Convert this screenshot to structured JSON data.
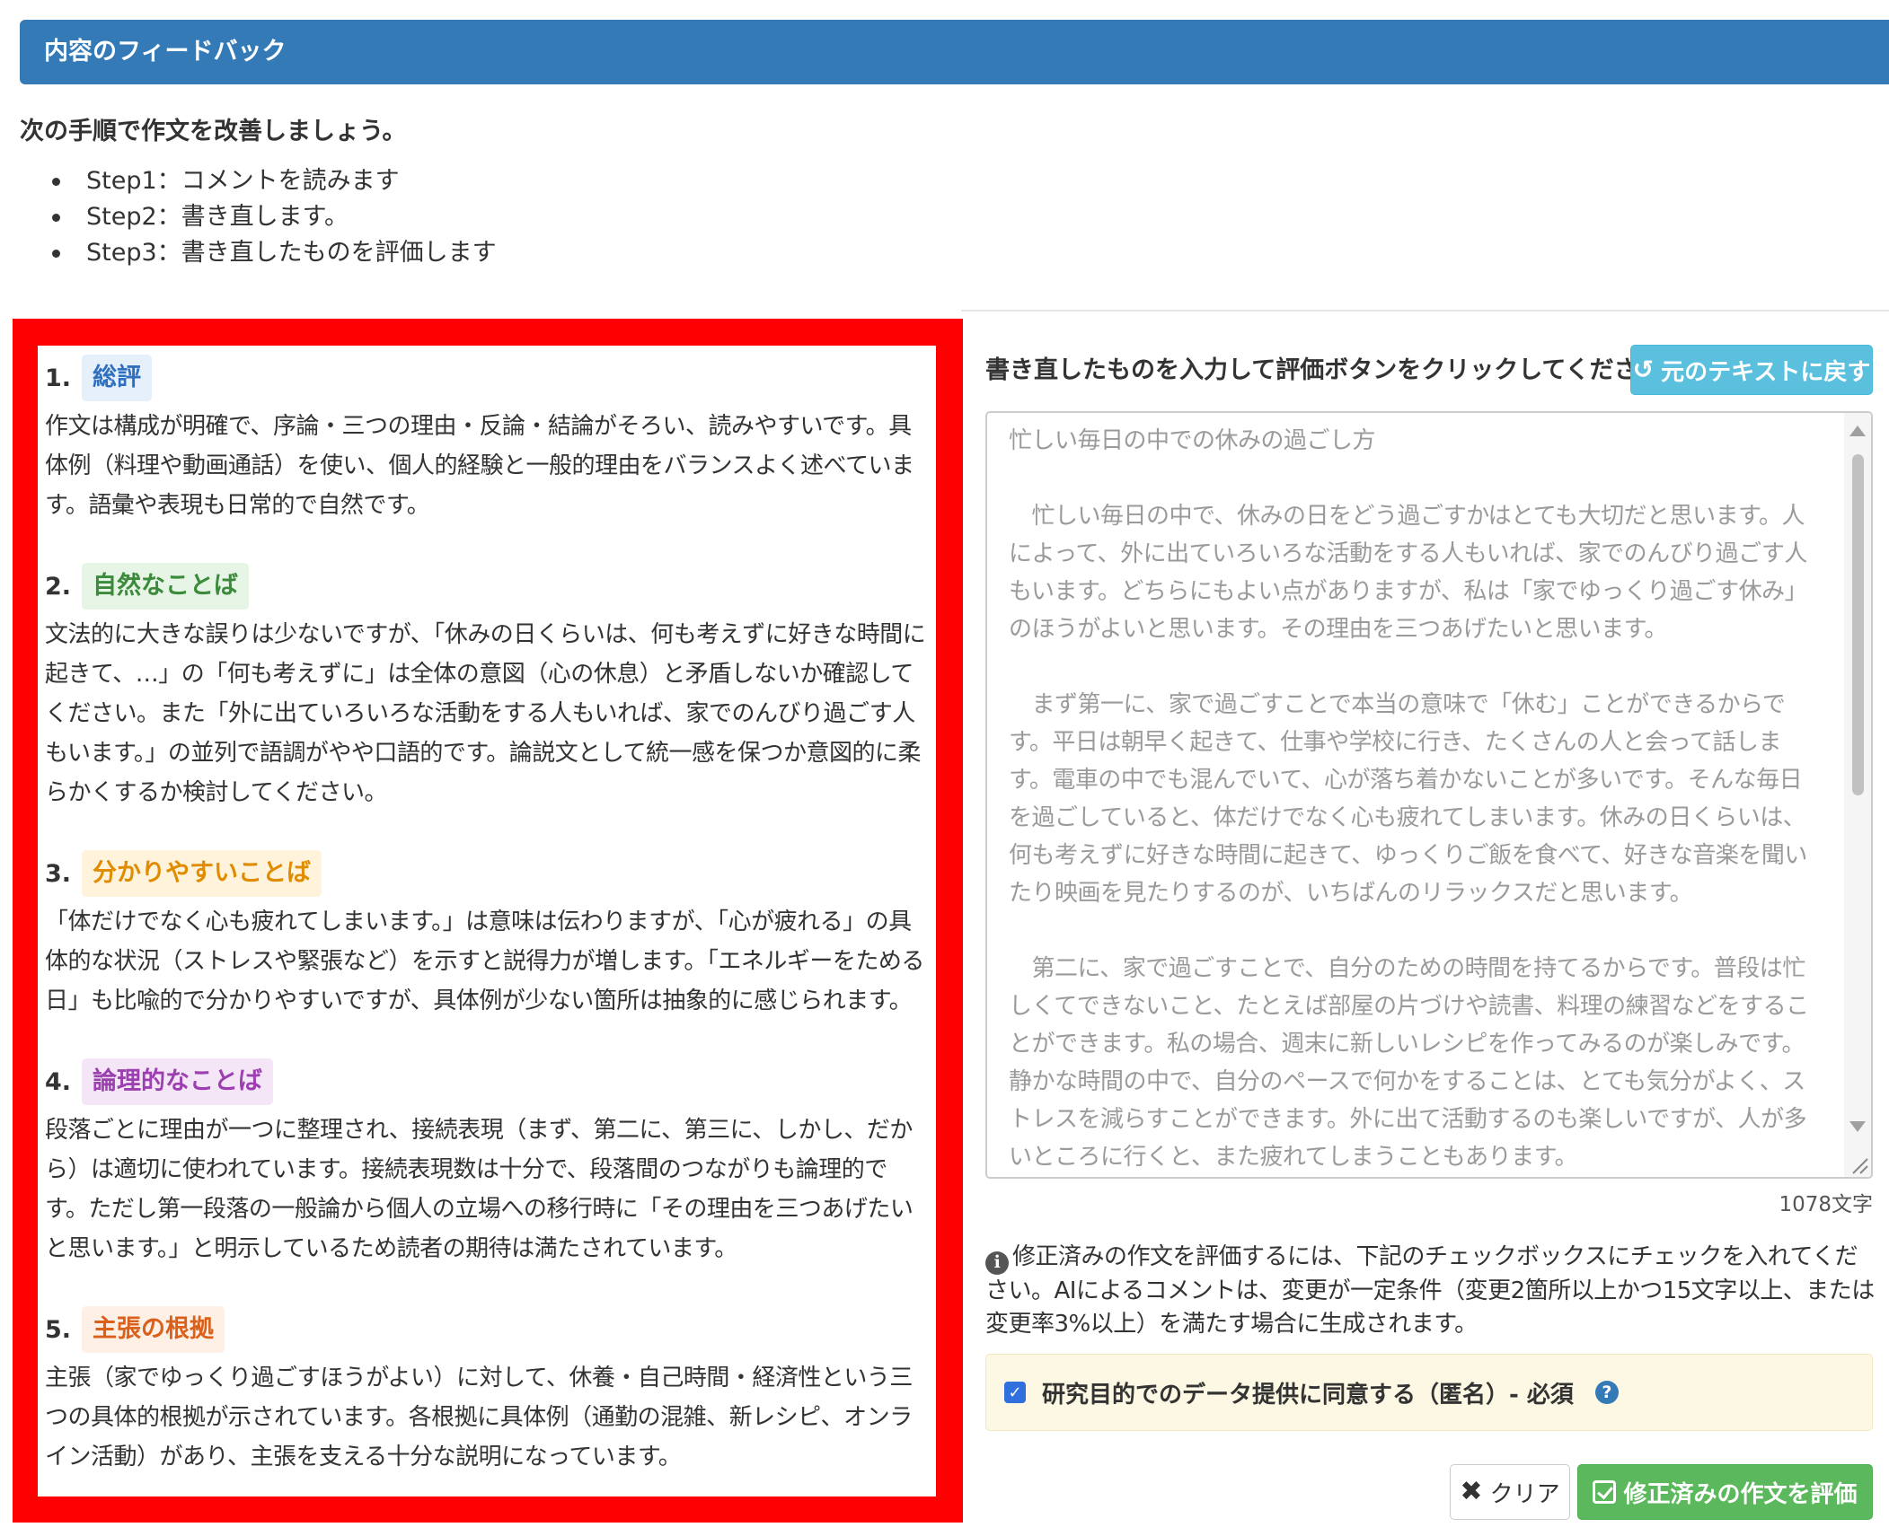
{
  "header": {
    "title": "内容のフィードバック"
  },
  "intro": {
    "heading": "次の手順で作文を改善しましょう。",
    "steps": [
      "Step1：コメントを読みます",
      "Step2：書き直します。",
      "Step3：書き直したものを評価します"
    ]
  },
  "feedback": {
    "sections": [
      {
        "number": "1.",
        "tag": "総評",
        "tag_color": "#2e6fc0",
        "body": "作文は構成が明確で、序論・三つの理由・反論・結論がそろい、読みやすいです。具体例（料理や動画通話）を使い、個人的経験と一般的理由をバランスよく述べています。語彙や表現も日常的で自然です。"
      },
      {
        "number": "2.",
        "tag": "自然なことば",
        "tag_color": "#3c8a3c",
        "body": "文法的に大きな誤りは少ないですが、「休みの日くらいは、何も考えずに好きな時間に起きて、…」の「何も考えずに」は全体の意図（心の休息）と矛盾しないか確認してください。また「外に出ていろいろな活動をする人もいれば、家でのんびり過ごす人もいます。」の並列で語調がやや口語的です。論説文として統一感を保つか意図的に柔らかくするか検討してください。"
      },
      {
        "number": "3.",
        "tag": "分かりやすいことば",
        "tag_color": "#e08c00",
        "body": "「体だけでなく心も疲れてしまいます。」は意味は伝わりますが、「心が疲れる」の具体的な状況（ストレスや緊張など）を示すと説得力が増します。「エネルギーをためる日」も比喩的で分かりやすいですが、具体例が少ない箇所は抽象的に感じられます。"
      },
      {
        "number": "4.",
        "tag": "論理的なことば",
        "tag_color": "#9c3fb0",
        "body": "段落ごとに理由が一つに整理され、接続表現（まず、第二に、第三に、しかし、だから）は適切に使われています。接続表現数は十分で、段落間のつながりも論理的です。ただし第一段落の一般論から個人の立場への移行時に「その理由を三つあげたいと思います。」と明示しているため読者の期待は満たされています。"
      },
      {
        "number": "5.",
        "tag": "主張の根拠",
        "tag_color": "#d9611c",
        "body": "主張（家でゆっくり過ごすほうがよい）に対して、休養・自己時間・経済性という三つの具体的根拠が示されています。各根拠に具体例（通勤の混雑、新レシピ、オンライン活動）があり、主張を支える十分な説明になっています。"
      }
    ]
  },
  "editor": {
    "label": "書き直したものを入力して評価ボタンをクリックしてください",
    "restore_button": "元のテキストに戻す",
    "text": "忙しい毎日の中での休みの過ごし方\n\n　忙しい毎日の中で、休みの日をどう過ごすかはとても大切だと思います。人によって、外に出ていろいろな活動をする人もいれば、家でのんびり過ごす人もいます。どちらにもよい点がありますが、私は「家でゆっくり過ごす休み」のほうがよいと思います。その理由を三つあげたいと思います。\n\n　まず第一に、家で過ごすことで本当の意味で「休む」ことができるからです。平日は朝早く起きて、仕事や学校に行き、たくさんの人と会って話します。電車の中でも混んでいて、心が落ち着かないことが多いです。そんな毎日を過ごしていると、体だけでなく心も疲れてしまいます。休みの日くらいは、何も考えずに好きな時間に起きて、ゆっくりご飯を食べて、好きな音楽を聞いたり映画を見たりするのが、いちばんのリラックスだと思います。\n\n　第二に、家で過ごすことで、自分のための時間を持てるからです。普段は忙しくてできないこと、たとえば部屋の片づけや読書、料理の練習などをすることができます。私の場合、週末に新しいレシピを作ってみるのが楽しみです。静かな時間の中で、自分のペースで何かをすることは、とても気分がよく、ストレスを減らすことができます。外に出て活動するのも楽しいですが、人が多いところに行くと、また疲れてしまうこともあります。",
    "char_count": "1078文字"
  },
  "info": {
    "text": "修正済みの作文を評価するには、下記のチェックボックスにチェックを入れてください。AIによるコメントは、変更が一定条件（変更2箇所以上かつ15文字以上、または変更率3%以上）を満たす場合に生成されます。"
  },
  "consent": {
    "label": "研究目的でのデータ提供に同意する（匿名）- 必須",
    "checked": true
  },
  "buttons": {
    "clear": "クリア",
    "evaluate": "修正済みの作文を評価"
  },
  "colors": {
    "header_bg": "#337ab7",
    "feedback_frame": "#ff0000",
    "info_button": "#5bc0de",
    "success_button": "#5cb85c",
    "consent_bg": "#fcf8e3"
  }
}
